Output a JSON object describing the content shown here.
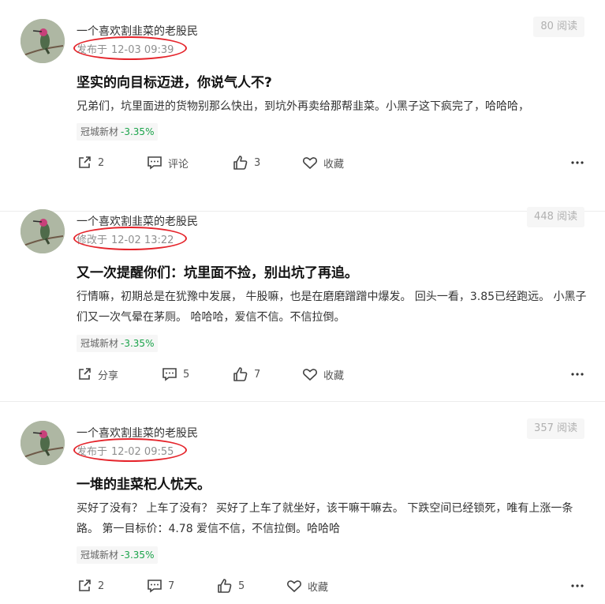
{
  "posts": [
    {
      "author": "一个喜欢割韭菜的老股民",
      "time_prefix": "发布于",
      "time": "12-03 09:39",
      "reads": "80 阅读",
      "title": "坚实的向目标迈进，你说气人不?",
      "body": "兄弟们，坑里面进的货物别那么快出，到坑外再卖给那帮韭菜。小黑子这下疯完了，哈哈哈，",
      "stock_name": "冠城新材",
      "stock_change": "-3.35%",
      "share_label": "2",
      "comment_label": "评论",
      "like_count": "3",
      "fav_label": "收藏"
    },
    {
      "author": "一个喜欢割韭菜的老股民",
      "time_prefix": "修改于",
      "time": "12-02 13:22",
      "reads": "448 阅读",
      "title": "又一次提醒你们：坑里面不捡，别出坑了再追。",
      "body": "行情嘛，初期总是在犹豫中发展， 牛股嘛，也是在磨磨蹭蹭中爆发。 回头一看，3.85已经跑远。 小黑子们又一次气晕在茅厕。 哈哈哈，爱信不信。不信拉倒。",
      "stock_name": "冠城新材",
      "stock_change": "-3.35%",
      "share_label": "分享",
      "comment_label": "5",
      "like_count": "7",
      "fav_label": "收藏"
    },
    {
      "author": "一个喜欢割韭菜的老股民",
      "time_prefix": "发布于",
      "time": "12-02 09:55",
      "reads": "357 阅读",
      "title": "一堆的韭菜杞人忧天。",
      "body": "买好了没有？ 上车了没有？ 买好了上车了就坐好，该干嘛干嘛去。 下跌空间已经锁死，唯有上涨一条路。 第一目标价：4.78 爱信不信，不信拉倒。哈哈哈",
      "stock_name": "冠城新材",
      "stock_change": "-3.35%",
      "share_label": "2",
      "comment_label": "7",
      "like_count": "5",
      "fav_label": "收藏"
    }
  ],
  "colors": {
    "stock_change": "#1aa34a",
    "annotation_circle": "#e5242b",
    "reads_bg": "#f6f6f6"
  },
  "icons": [
    "avatar-hummingbird",
    "share-icon",
    "comment-icon",
    "like-icon",
    "favorite-icon",
    "more-icon"
  ]
}
